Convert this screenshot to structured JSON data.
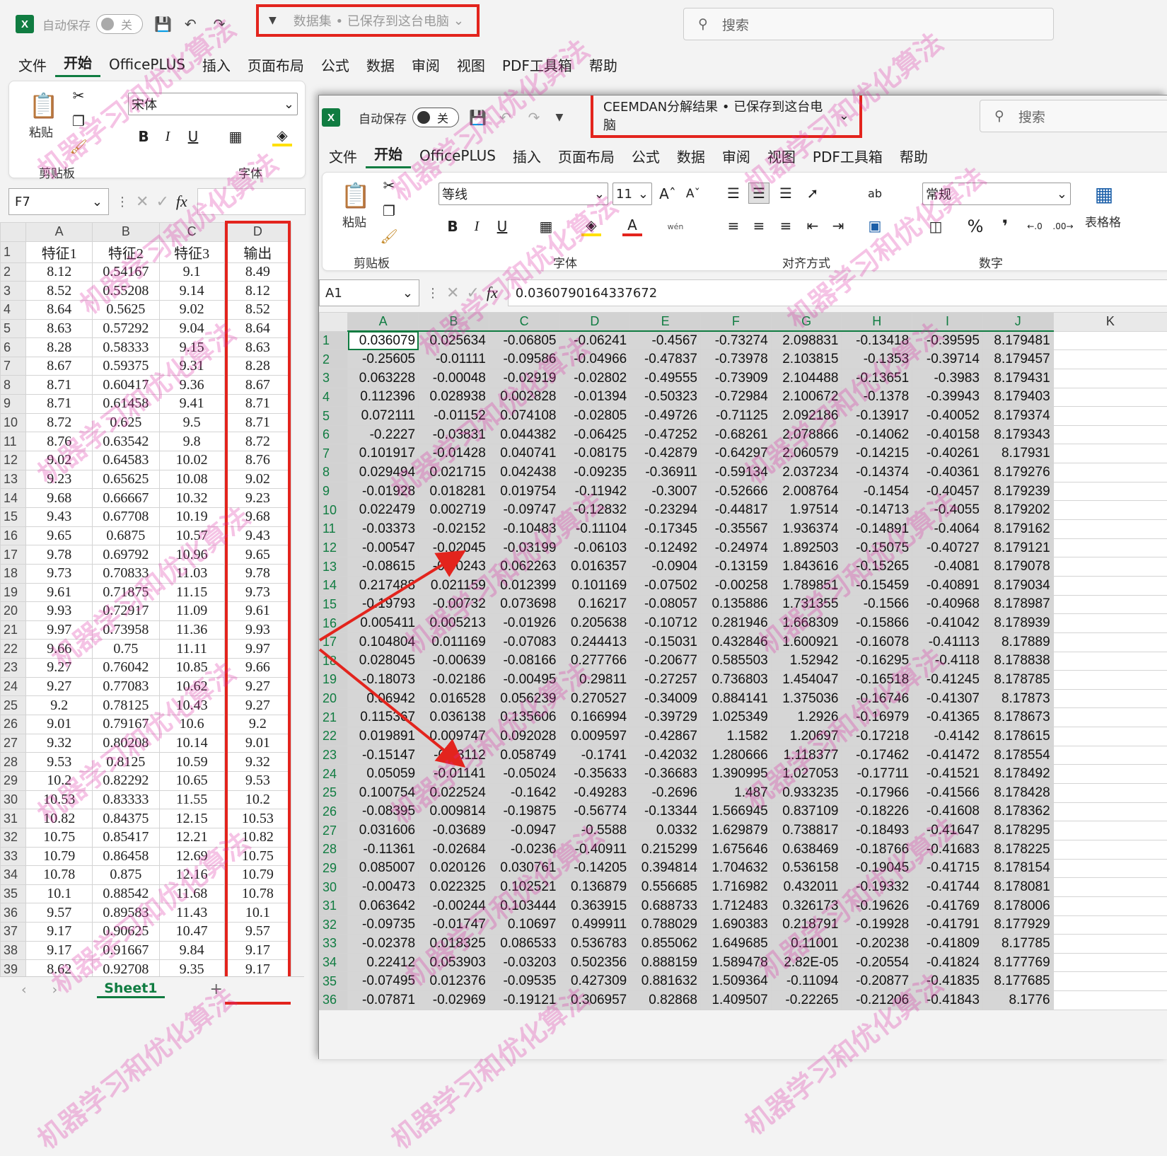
{
  "win1": {
    "autosave_label": "自动保存",
    "toggle_label": "关",
    "title": "数据集 • 已保存到这台电脑",
    "search_placeholder": "搜索",
    "menu": [
      "文件",
      "开始",
      "OfficePLUS",
      "插入",
      "页面布局",
      "公式",
      "数据",
      "审阅",
      "视图",
      "PDF工具箱",
      "帮助"
    ],
    "active_menu": "开始",
    "ribbon": {
      "paste_label": "粘贴",
      "clipboard_label": "剪贴板",
      "font_group_label": "字体",
      "font_name": "宋体"
    },
    "name_box": "F7",
    "fx_label": "fx",
    "columns": [
      "A",
      "B",
      "C",
      "D"
    ],
    "rows": [
      [
        "特征1",
        "特征2",
        "特征3",
        "输出"
      ],
      [
        "8.12",
        "0.54167",
        "9.1",
        "8.49"
      ],
      [
        "8.52",
        "0.55208",
        "9.14",
        "8.12"
      ],
      [
        "8.64",
        "0.5625",
        "9.02",
        "8.52"
      ],
      [
        "8.63",
        "0.57292",
        "9.04",
        "8.64"
      ],
      [
        "8.28",
        "0.58333",
        "9.15",
        "8.63"
      ],
      [
        "8.67",
        "0.59375",
        "9.31",
        "8.28"
      ],
      [
        "8.71",
        "0.60417",
        "9.36",
        "8.67"
      ],
      [
        "8.71",
        "0.61458",
        "9.41",
        "8.71"
      ],
      [
        "8.72",
        "0.625",
        "9.5",
        "8.71"
      ],
      [
        "8.76",
        "0.63542",
        "9.8",
        "8.72"
      ],
      [
        "9.02",
        "0.64583",
        "10.02",
        "8.76"
      ],
      [
        "9.23",
        "0.65625",
        "10.08",
        "9.02"
      ],
      [
        "9.68",
        "0.66667",
        "10.32",
        "9.23"
      ],
      [
        "9.43",
        "0.67708",
        "10.19",
        "9.68"
      ],
      [
        "9.65",
        "0.6875",
        "10.57",
        "9.43"
      ],
      [
        "9.78",
        "0.69792",
        "10.96",
        "9.65"
      ],
      [
        "9.73",
        "0.70833",
        "11.03",
        "9.78"
      ],
      [
        "9.61",
        "0.71875",
        "11.15",
        "9.73"
      ],
      [
        "9.93",
        "0.72917",
        "11.09",
        "9.61"
      ],
      [
        "9.97",
        "0.73958",
        "11.36",
        "9.93"
      ],
      [
        "9.66",
        "0.75",
        "11.11",
        "9.97"
      ],
      [
        "9.27",
        "0.76042",
        "10.85",
        "9.66"
      ],
      [
        "9.27",
        "0.77083",
        "10.62",
        "9.27"
      ],
      [
        "9.2",
        "0.78125",
        "10.43",
        "9.27"
      ],
      [
        "9.01",
        "0.79167",
        "10.6",
        "9.2"
      ],
      [
        "9.32",
        "0.80208",
        "10.14",
        "9.01"
      ],
      [
        "9.53",
        "0.8125",
        "10.59",
        "9.32"
      ],
      [
        "10.2",
        "0.82292",
        "10.65",
        "9.53"
      ],
      [
        "10.53",
        "0.83333",
        "11.55",
        "10.2"
      ],
      [
        "10.82",
        "0.84375",
        "12.15",
        "10.53"
      ],
      [
        "10.75",
        "0.85417",
        "12.21",
        "10.82"
      ],
      [
        "10.79",
        "0.86458",
        "12.69",
        "10.75"
      ],
      [
        "10.78",
        "0.875",
        "12.16",
        "10.79"
      ],
      [
        "10.1",
        "0.88542",
        "11.68",
        "10.78"
      ],
      [
        "9.57",
        "0.89583",
        "11.43",
        "10.1"
      ],
      [
        "9.17",
        "0.90625",
        "10.47",
        "9.57"
      ],
      [
        "9.17",
        "0.91667",
        "9.84",
        "9.17"
      ],
      [
        "8.62",
        "0.92708",
        "9.35",
        "9.17"
      ]
    ],
    "sheet_tab": "Sheet1",
    "add_sheet": "+"
  },
  "win2": {
    "autosave_label": "自动保存",
    "toggle_label": "关",
    "title": "CEEMDAN分解结果 • 已保存到这台电脑",
    "search_placeholder": "搜索",
    "menu": [
      "文件",
      "开始",
      "OfficePLUS",
      "插入",
      "页面布局",
      "公式",
      "数据",
      "审阅",
      "视图",
      "PDF工具箱",
      "帮助"
    ],
    "active_menu": "开始",
    "ribbon": {
      "paste_label": "粘贴",
      "clipboard_label": "剪贴板",
      "font_group_label": "字体",
      "align_group_label": "对齐方式",
      "number_group_label": "数字",
      "table_label": "表格格",
      "font_name": "等线",
      "font_size": "11",
      "number_format": "常规",
      "wen_label": "wén"
    },
    "name_box": "A1",
    "fx_label": "fx",
    "formula": "0.0360790164337672",
    "columns": [
      "A",
      "B",
      "C",
      "D",
      "E",
      "F",
      "G",
      "H",
      "I",
      "J",
      "K"
    ],
    "rows": [
      [
        "0.036079",
        "0.025634",
        "-0.06805",
        "-0.06241",
        "-0.4567",
        "-0.73274",
        "2.098831",
        "-0.13418",
        "-0.39595",
        "8.179481"
      ],
      [
        "-0.25605",
        "-0.01111",
        "-0.09586",
        "-0.04966",
        "-0.47837",
        "-0.73978",
        "2.103815",
        "-0.1353",
        "-0.39714",
        "8.179457"
      ],
      [
        "0.063228",
        "-0.00048",
        "-0.02919",
        "-0.02802",
        "-0.49555",
        "-0.73909",
        "2.104488",
        "-0.13651",
        "-0.3983",
        "8.179431"
      ],
      [
        "0.112396",
        "0.028938",
        "0.002828",
        "-0.01394",
        "-0.50323",
        "-0.72984",
        "2.100672",
        "-0.1378",
        "-0.39943",
        "8.179403"
      ],
      [
        "0.072111",
        "-0.01152",
        "0.074108",
        "-0.02805",
        "-0.49726",
        "-0.71125",
        "2.092186",
        "-0.13917",
        "-0.40052",
        "8.179374"
      ],
      [
        "-0.2227",
        "-0.03831",
        "0.044382",
        "-0.06425",
        "-0.47252",
        "-0.68261",
        "2.078866",
        "-0.14062",
        "-0.40158",
        "8.179343"
      ],
      [
        "0.101917",
        "-0.01428",
        "0.040741",
        "-0.08175",
        "-0.42879",
        "-0.64297",
        "2.060579",
        "-0.14215",
        "-0.40261",
        "8.17931"
      ],
      [
        "0.029494",
        "0.021715",
        "0.042438",
        "-0.09235",
        "-0.36911",
        "-0.59134",
        "2.037234",
        "-0.14374",
        "-0.40361",
        "8.179276"
      ],
      [
        "-0.01928",
        "0.018281",
        "0.019754",
        "-0.11942",
        "-0.3007",
        "-0.52666",
        "2.008764",
        "-0.1454",
        "-0.40457",
        "8.179239"
      ],
      [
        "0.022479",
        "0.002719",
        "-0.09747",
        "-0.12832",
        "-0.23294",
        "-0.44817",
        "1.97514",
        "-0.14713",
        "-0.4055",
        "8.179202"
      ],
      [
        "-0.03373",
        "-0.02152",
        "-0.10483",
        "-0.11104",
        "-0.17345",
        "-0.35567",
        "1.936374",
        "-0.14891",
        "-0.4064",
        "8.179162"
      ],
      [
        "-0.00547",
        "-0.02045",
        "-0.03199",
        "-0.06103",
        "-0.12492",
        "-0.24974",
        "1.892503",
        "-0.15075",
        "-0.40727",
        "8.179121"
      ],
      [
        "-0.08615",
        "-0.00243",
        "0.062263",
        "0.016357",
        "-0.0904",
        "-0.13159",
        "1.843616",
        "-0.15265",
        "-0.4081",
        "8.179078"
      ],
      [
        "0.217488",
        "0.021159",
        "0.012399",
        "0.101169",
        "-0.07502",
        "-0.00258",
        "1.789851",
        "-0.15459",
        "-0.40891",
        "8.179034"
      ],
      [
        "-0.19793",
        "-0.00732",
        "0.073698",
        "0.16217",
        "-0.08057",
        "0.135886",
        "1.731355",
        "-0.1566",
        "-0.40968",
        "8.178987"
      ],
      [
        "0.005411",
        "0.005213",
        "-0.01926",
        "0.205638",
        "-0.10712",
        "0.281946",
        "1.668309",
        "-0.15866",
        "-0.41042",
        "8.178939"
      ],
      [
        "0.104804",
        "0.011169",
        "-0.07083",
        "0.244413",
        "-0.15031",
        "0.432846",
        "1.600921",
        "-0.16078",
        "-0.41113",
        "8.17889"
      ],
      [
        "0.028045",
        "-0.00639",
        "-0.08166",
        "0.277766",
        "-0.20677",
        "0.585503",
        "1.52942",
        "-0.16295",
        "-0.4118",
        "8.178838"
      ],
      [
        "-0.18073",
        "-0.02186",
        "-0.00495",
        "0.29811",
        "-0.27257",
        "0.736803",
        "1.454047",
        "-0.16518",
        "-0.41245",
        "8.178785"
      ],
      [
        "0.06942",
        "0.016528",
        "0.056239",
        "0.270527",
        "-0.34009",
        "0.884141",
        "1.375036",
        "-0.16746",
        "-0.41307",
        "8.17873"
      ],
      [
        "0.115367",
        "0.036138",
        "0.135606",
        "0.166994",
        "-0.39729",
        "1.025349",
        "1.2926",
        "-0.16979",
        "-0.41365",
        "8.178673"
      ],
      [
        "0.019891",
        "0.009747",
        "0.092028",
        "0.009597",
        "-0.42867",
        "1.1582",
        "1.20697",
        "-0.17218",
        "-0.4142",
        "8.178615"
      ],
      [
        "-0.15147",
        "-0.03112",
        "0.058749",
        "-0.1741",
        "-0.42032",
        "1.280666",
        "1.118377",
        "-0.17462",
        "-0.41472",
        "8.178554"
      ],
      [
        "0.05059",
        "-0.01141",
        "-0.05024",
        "-0.35633",
        "-0.36683",
        "1.390995",
        "1.027053",
        "-0.17711",
        "-0.41521",
        "8.178492"
      ],
      [
        "0.100754",
        "0.022524",
        "-0.1642",
        "-0.49283",
        "-0.2696",
        "1.487",
        "0.933235",
        "-0.17966",
        "-0.41566",
        "8.178428"
      ],
      [
        "-0.08395",
        "0.009814",
        "-0.19875",
        "-0.56774",
        "-0.13344",
        "1.566945",
        "0.837109",
        "-0.18226",
        "-0.41608",
        "8.178362"
      ],
      [
        "0.031606",
        "-0.03689",
        "-0.0947",
        "-0.5588",
        "0.0332",
        "1.629879",
        "0.738817",
        "-0.18493",
        "-0.41647",
        "8.178295"
      ],
      [
        "-0.11361",
        "-0.02684",
        "-0.0236",
        "-0.40911",
        "0.215299",
        "1.675646",
        "0.638469",
        "-0.18766",
        "-0.41683",
        "8.178225"
      ],
      [
        "0.085007",
        "0.020126",
        "0.030761",
        "-0.14205",
        "0.394814",
        "1.704632",
        "0.536158",
        "-0.19045",
        "-0.41715",
        "8.178154"
      ],
      [
        "-0.00473",
        "0.022325",
        "0.102521",
        "0.136879",
        "0.556685",
        "1.716982",
        "0.432011",
        "-0.19332",
        "-0.41744",
        "8.178081"
      ],
      [
        "0.063642",
        "-0.00244",
        "0.103444",
        "0.363915",
        "0.688733",
        "1.712483",
        "0.326173",
        "-0.19626",
        "-0.41769",
        "8.178006"
      ],
      [
        "-0.09735",
        "-0.01747",
        "0.10697",
        "0.499911",
        "0.788029",
        "1.690383",
        "0.218791",
        "-0.19928",
        "-0.41791",
        "8.177929"
      ],
      [
        "-0.02378",
        "0.018325",
        "0.086533",
        "0.536783",
        "0.855062",
        "1.649685",
        "0.11001",
        "-0.20238",
        "-0.41809",
        "8.17785"
      ],
      [
        "0.22412",
        "0.053903",
        "-0.03203",
        "0.502356",
        "0.888159",
        "1.589478",
        "2.82E-05",
        "-0.20554",
        "-0.41824",
        "8.177769"
      ],
      [
        "-0.07495",
        "0.012376",
        "-0.09535",
        "0.427309",
        "0.881632",
        "1.509364",
        "-0.11094",
        "-0.20877",
        "-0.41835",
        "8.177685"
      ],
      [
        "-0.07871",
        "-0.02969",
        "-0.19121",
        "0.306957",
        "0.82868",
        "1.409507",
        "-0.22265",
        "-0.21206",
        "-0.41843",
        "8.1776"
      ]
    ]
  },
  "watermark": "机器学习和优化算法"
}
